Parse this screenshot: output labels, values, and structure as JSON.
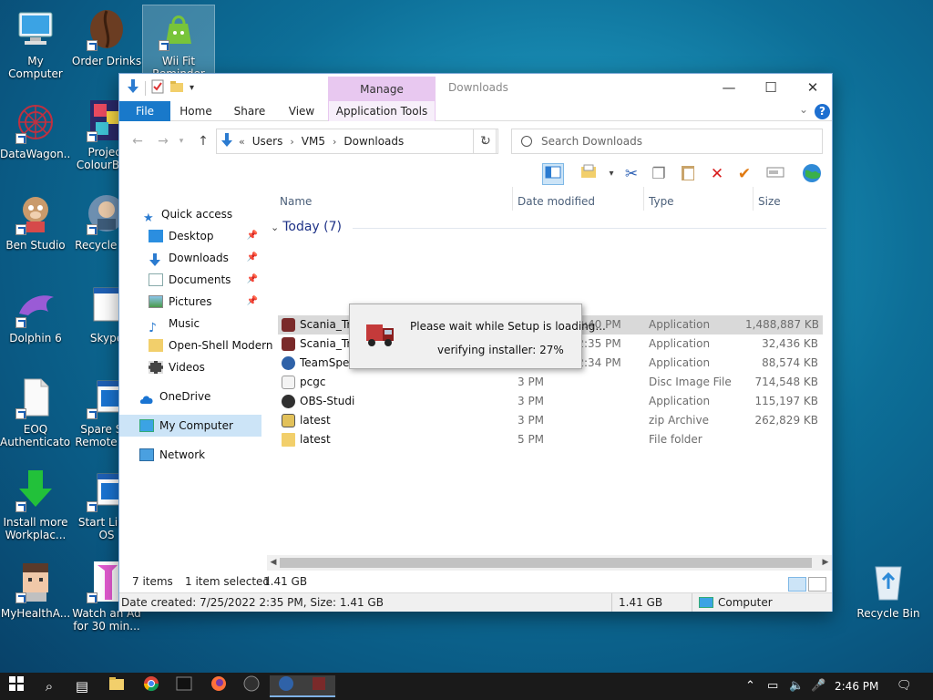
{
  "desktop": {
    "icons": [
      {
        "label": "My Computer"
      },
      {
        "label": "Order Drinks"
      },
      {
        "label": "Wii Fit Reminder"
      },
      {
        "label": "DataWagon..."
      },
      {
        "label": "Project ColourBu..."
      },
      {
        "label": "Ben Studio"
      },
      {
        "label": "Recycle B..."
      },
      {
        "label": "Dolphin 6"
      },
      {
        "label": "Skype"
      },
      {
        "label": "EOQ Authenticator"
      },
      {
        "label": "Spare S... Remote 2..."
      },
      {
        "label": "Install more Workplac..."
      },
      {
        "label": "Start Lin... OS"
      },
      {
        "label": "MyHealthA..."
      },
      {
        "label": "Watch an Ad for 30 min..."
      },
      {
        "label": "Recycle Bin"
      }
    ]
  },
  "window": {
    "title": "Downloads",
    "context_tab": "Manage",
    "tabs": [
      "File",
      "Home",
      "Share",
      "View",
      "Application Tools"
    ],
    "controls": {
      "minimize": "—",
      "maximize": "☐",
      "close": "✕"
    },
    "address": {
      "prefix": "«",
      "segments": [
        "Users",
        "VM5",
        "Downloads"
      ]
    },
    "search_placeholder": "Search Downloads",
    "nav": [
      {
        "label": "Quick access"
      },
      {
        "label": "Desktop"
      },
      {
        "label": "Downloads"
      },
      {
        "label": "Documents"
      },
      {
        "label": "Pictures"
      },
      {
        "label": "Music"
      },
      {
        "label": "Open-Shell Modern"
      },
      {
        "label": "Videos"
      },
      {
        "label": "OneDrive"
      },
      {
        "label": "My Computer"
      },
      {
        "label": "Network"
      }
    ],
    "columns": {
      "name": "Name",
      "date": "Date modified",
      "type": "Type",
      "size": "Size"
    },
    "group": "Today (7)",
    "files": [
      {
        "name": "Scania_Truck  Driving Simulator_Extended",
        "date": "7/25/2022 2:40 PM",
        "type": "Application",
        "size": "1,488,887 KB",
        "icon_color": "#7a2a2a"
      },
      {
        "name": "Scania_Truck  Driving Simulator_1_5_0_Pa...",
        "date": "7/25/2022 2:35 PM",
        "type": "Application",
        "size": "32,436 KB",
        "icon_color": "#7a2a2a"
      },
      {
        "name": "TeamSpeak3-Client-win64-3.5.6",
        "date": "7/25/2022 2:34 PM",
        "type": "Application",
        "size": "88,574 KB",
        "icon_color": "#2f62a8"
      },
      {
        "name": "pcgc",
        "date": "3 PM",
        "type": "Disc Image File",
        "size": "714,548 KB",
        "icon_color": "#e8e8e8"
      },
      {
        "name": "OBS-Studi",
        "date": "3 PM",
        "type": "Application",
        "size": "115,197 KB",
        "icon_color": "#303030"
      },
      {
        "name": "latest",
        "date": "3 PM",
        "type": "zip Archive",
        "size": "262,829 KB",
        "icon_color": "#e2c15a"
      },
      {
        "name": "latest",
        "date": "5 PM",
        "type": "File folder",
        "size": "",
        "icon_color": "#f2cf6b"
      }
    ],
    "status": {
      "items": "7 items",
      "selected": "1 item selected",
      "size": "1.41 GB"
    },
    "details": {
      "created": "Date created: 7/25/2022 2:35 PM, Size: 1.41 GB",
      "size": "1.41 GB",
      "location": "Computer"
    }
  },
  "setup_dialog": {
    "line1": "Please wait while Setup is loading...",
    "line2": "verifying installer: 27%"
  },
  "taskbar": {
    "time": "2:46 PM"
  }
}
